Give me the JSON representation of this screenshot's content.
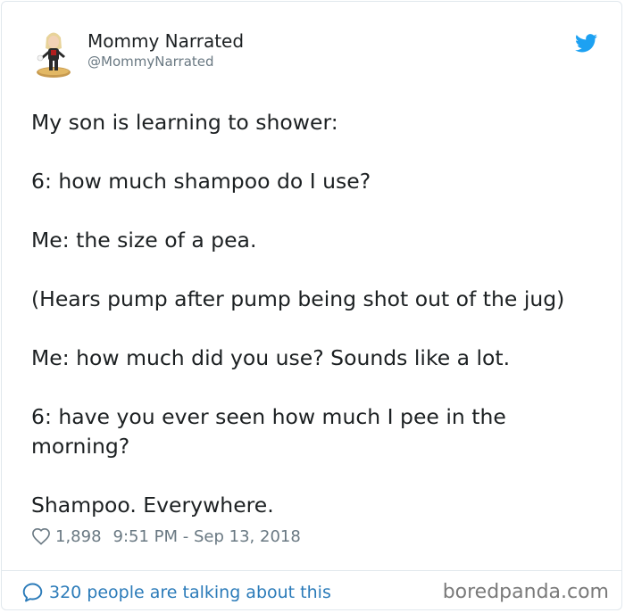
{
  "author": {
    "name": "Mommy Narrated",
    "handle": "@MommyNarrated"
  },
  "tweet": {
    "paragraphs": [
      "My son is learning to shower:",
      "6: how much shampoo do I use?",
      "Me: the size of a pea.",
      "(Hears pump after pump being shot out of the jug)",
      "Me: how much did you use? Sounds like a lot.",
      "6: have you ever seen how much I pee in the morning?",
      "Shampoo. Everywhere."
    ],
    "likes": "1,898",
    "timestamp": "9:51 PM - Sep 13, 2018"
  },
  "footer": {
    "talking": "320 people are talking about this",
    "watermark": "boredpanda.com"
  },
  "icons": {
    "brand": "twitter-bird-icon",
    "like": "heart-icon",
    "comment": "speech-bubble-icon"
  },
  "colors": {
    "twitter_blue": "#1da1f2",
    "link_blue": "#2b7bb9",
    "text": "#1c2022",
    "muted": "#697882",
    "border": "#e1e8ed",
    "watermark": "#7a7a7a"
  }
}
